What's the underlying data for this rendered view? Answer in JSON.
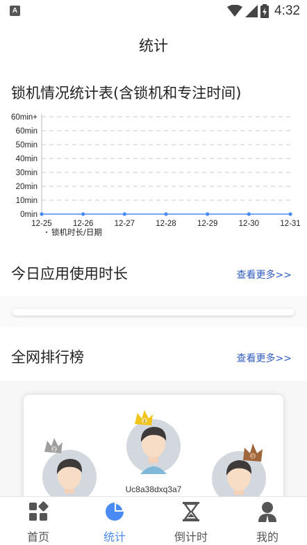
{
  "statusbar": {
    "notification_letter": "A",
    "time": "4:32"
  },
  "page": {
    "title": "统计"
  },
  "lock_section": {
    "title": "锁机情况统计表(含锁机和专注时间)"
  },
  "chart_data": {
    "type": "line",
    "x": [
      "12-25",
      "12-26",
      "12-27",
      "12-28",
      "12-29",
      "12-30",
      "12-31"
    ],
    "series": [
      {
        "name": "锁机时长/日期",
        "values": [
          0,
          0,
          0,
          0,
          0,
          0,
          0
        ]
      }
    ],
    "y_ticks": [
      "0min",
      "10min",
      "20min",
      "30min",
      "40min",
      "50min",
      "60min",
      "60min+"
    ],
    "ylim": [
      0,
      70
    ],
    "grid": "dashed-horizontal",
    "legend": "bottom-left",
    "line_color": "#4a8af4"
  },
  "usage_section": {
    "title": "今日应用使用时长",
    "more": "查看更多>>"
  },
  "rank_section": {
    "title": "全网排行榜",
    "more": "查看更多>>",
    "users": [
      {
        "rank": "1",
        "name": "Uc8a38dxq3a7",
        "crown_color": "#f0c419"
      },
      {
        "rank": "2",
        "crown_color": "#9e9e9e"
      },
      {
        "rank": "3",
        "crown_color": "#a0673c"
      }
    ]
  },
  "bottom_nav": {
    "items": [
      {
        "label": "首页",
        "icon": "home-grid-icon"
      },
      {
        "label": "统计",
        "icon": "pie-chart-icon",
        "active": true
      },
      {
        "label": "倒计时",
        "icon": "hourglass-icon"
      },
      {
        "label": "我的",
        "icon": "user-icon"
      }
    ]
  }
}
